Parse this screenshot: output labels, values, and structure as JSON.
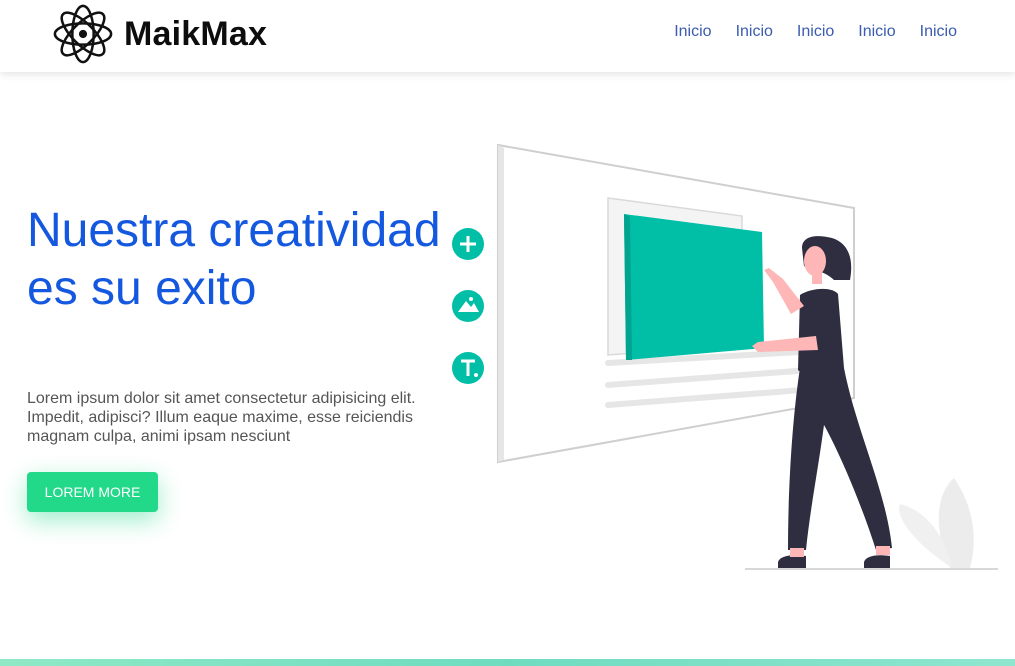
{
  "brand": {
    "name": "MaikMax",
    "logo_icon": "atom-icon"
  },
  "nav": {
    "items": [
      {
        "label": "Inicio"
      },
      {
        "label": "Inicio"
      },
      {
        "label": "Inicio"
      },
      {
        "label": "Inicio"
      },
      {
        "label": "Inicio"
      }
    ]
  },
  "hero": {
    "title": "Nuestra creatividad es su exito",
    "description": "Lorem ipsum dolor sit amet consectetur adipisicing elit. Impedit, adipisci? Illum eaque maxime, esse reiciendis magnam culpa, animi ipsam nesciunt",
    "cta_label": "LOREM MORE"
  },
  "illustration": {
    "icons": [
      "plus-icon",
      "image-icon",
      "text-icon"
    ]
  },
  "colors": {
    "title": "#1558e0",
    "nav_link": "#3a5bb0",
    "cta": "#22d98a",
    "accent_teal": "#00bfa6",
    "figure_dark": "#2f2e41",
    "skin": "#ffb6b6"
  }
}
